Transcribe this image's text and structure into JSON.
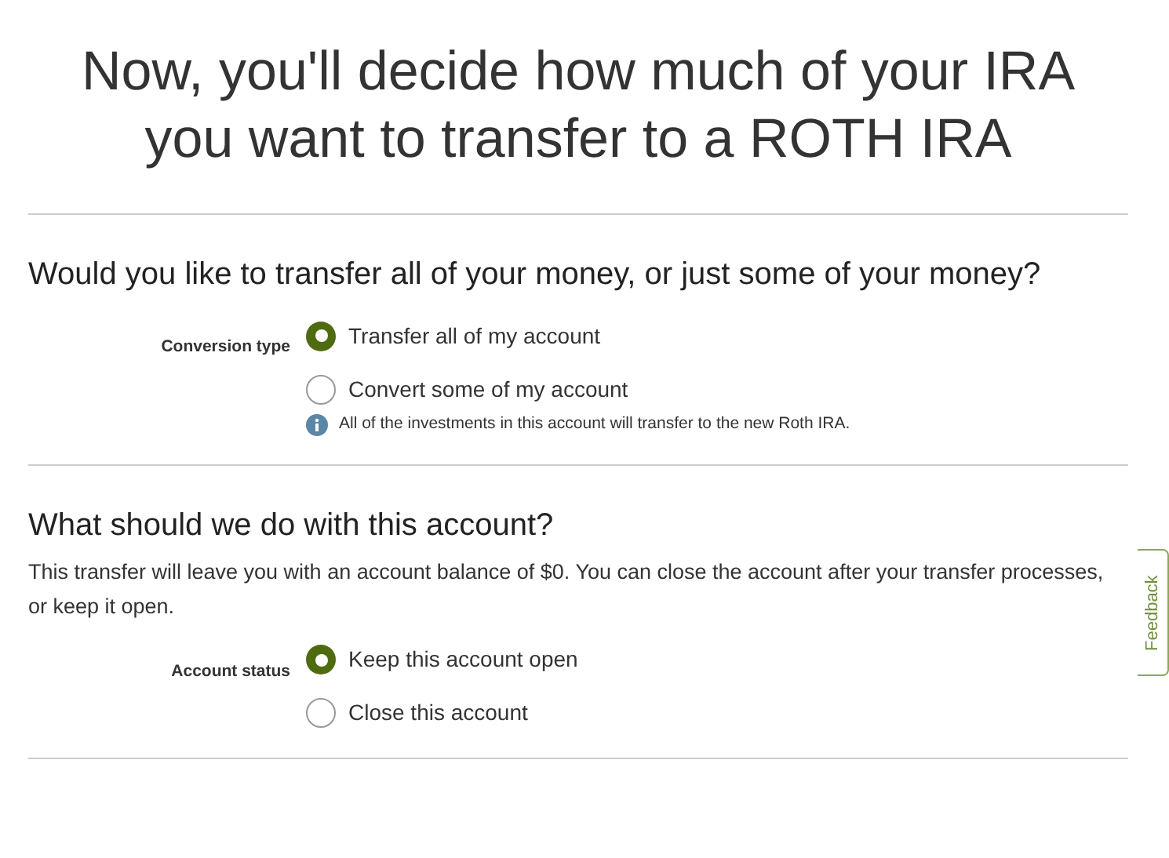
{
  "title": "Now, you'll decide how much of your IRA you want to transfer to a ROTH IRA",
  "sections": [
    {
      "heading": "Would you like to transfer all of your money, or just some of your money?",
      "field_label": "Conversion type",
      "options": [
        {
          "label": "Transfer all of my account",
          "selected": true
        },
        {
          "label": "Convert some of my account",
          "selected": false
        }
      ],
      "info": "All of the investments in this account will transfer to the new Roth IRA."
    },
    {
      "heading": "What should we do with this account?",
      "description": "This transfer will leave you with an account balance of $0. You can close the account after your transfer processes, or keep it open.",
      "field_label": "Account status",
      "options": [
        {
          "label": "Keep this account open",
          "selected": true
        },
        {
          "label": "Close this account",
          "selected": false
        }
      ]
    }
  ],
  "feedback_tab": "Feedback"
}
